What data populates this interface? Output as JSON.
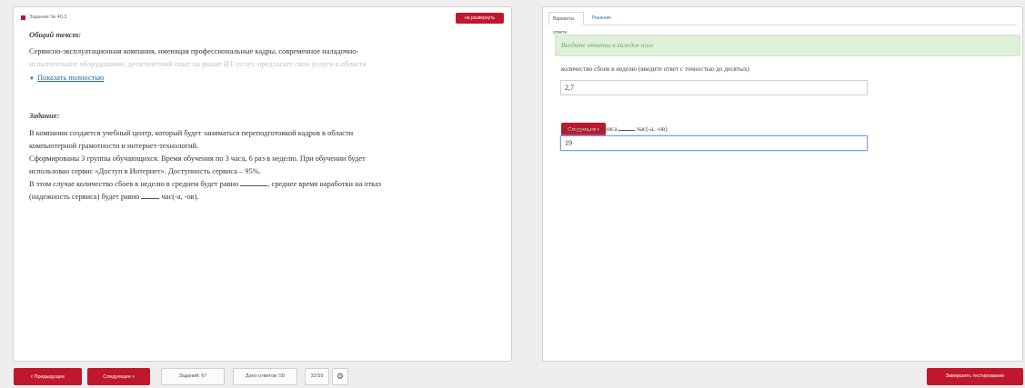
{
  "left_panel": {
    "task_title": "Задание № 40.3",
    "expand_button": "на развернуть",
    "general_heading": "Общий текст:",
    "general_text_line1": "Сервисно-эксплуатационная компания, имеющая профессиональные кадры, современное наладочно-",
    "general_text_line2": "испытательное оборудование, десятилетний опыт на рынке ИТ-услуг, предлагает свои услуги в области",
    "show_full_link": "Показать полностью",
    "task_heading": "Задание:",
    "task_line1": "В компании создается учебный центр, который будет заниматься переподготовкой кадров в области",
    "task_line2": "компьютерной грамотности и интернет-технологий.",
    "task_line3": "Сформированы 3 группы обучающихся. Время обучения по 3 часа, 6 раз в неделю. При обучении будет",
    "task_line4": "использован сервис «Доступ в Интернет». Доступность сервиса – 95%.",
    "task_line5_a": "В этом случае количество сбоев в неделю в среднем будет равно",
    "task_line5_b": ", среднее время наработки на отказ",
    "task_line6_a": "(надежность сервиса) будет равно",
    "task_line6_b": "час(-а, -ов)."
  },
  "right_panel": {
    "tabs": [
      "Варианты ответа",
      "Решение"
    ],
    "alert": "Введите ответы в каждое поле",
    "q1_label": "количество сбоев в неделю (введите ответ с точностью до десятых)",
    "q1_value": "2,7",
    "next_button": "Следующее",
    "q2_label_a": "надежность сервиса",
    "q2_label_b": "час(-а, -ов)",
    "q2_value": "19"
  },
  "bottom_bar": {
    "prev_button": "Предыдущее",
    "next_button": "Следующее",
    "tasks_label": "Заданий: 67",
    "answers_label": "Дано ответов: 58",
    "timer": "33:59",
    "finish_button": "Завершить тестирование"
  },
  "colors": {
    "accent_red": "#c0172d",
    "link_blue": "#1f62a8",
    "alert_green_bg": "#dff0d8",
    "focus_border": "#7aa5d8"
  },
  "icons": {
    "prev": "chevron-left-icon",
    "next": "chevron-right-icon",
    "settings": "gear-icon",
    "show_more": "triangle-down-icon"
  }
}
